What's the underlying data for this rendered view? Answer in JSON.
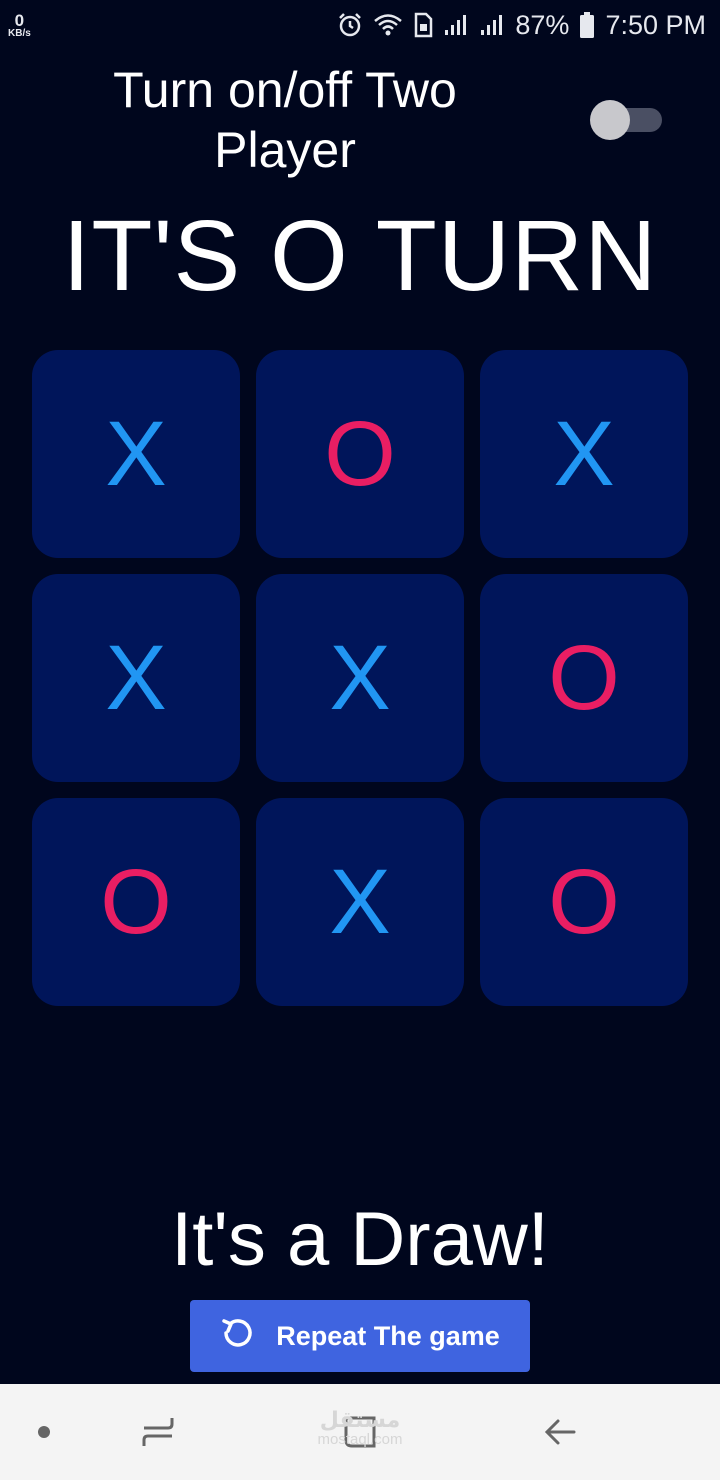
{
  "status_bar": {
    "net_speed_value": "0",
    "net_speed_unit": "KB/s",
    "battery_percent": "87%",
    "time": "7:50 PM",
    "icons": [
      "alarm-icon",
      "wifi-icon",
      "sim-icon",
      "signal-icon",
      "signal-icon",
      "battery-icon"
    ]
  },
  "header": {
    "two_player_label": "Turn on/off Two Player",
    "two_player_enabled": false
  },
  "turn_title": "IT'S O TURN",
  "board": {
    "cells": [
      "X",
      "O",
      "X",
      "X",
      "X",
      "O",
      "O",
      "X",
      "O"
    ]
  },
  "result_text": "It's a Draw!",
  "repeat_button": {
    "label": "Repeat The game",
    "icon": "replay-icon"
  },
  "watermark": {
    "logo_text": "مستقل",
    "domain": "mostaql.com"
  },
  "nav_bar": {
    "icons": [
      "dot-icon",
      "recent-apps-icon",
      "home-icon",
      "back-icon"
    ]
  },
  "colors": {
    "background": "#00061d",
    "cell": "#00155a",
    "mark_x": "#2196f3",
    "mark_o": "#e91e63",
    "button": "#3f64e0"
  }
}
